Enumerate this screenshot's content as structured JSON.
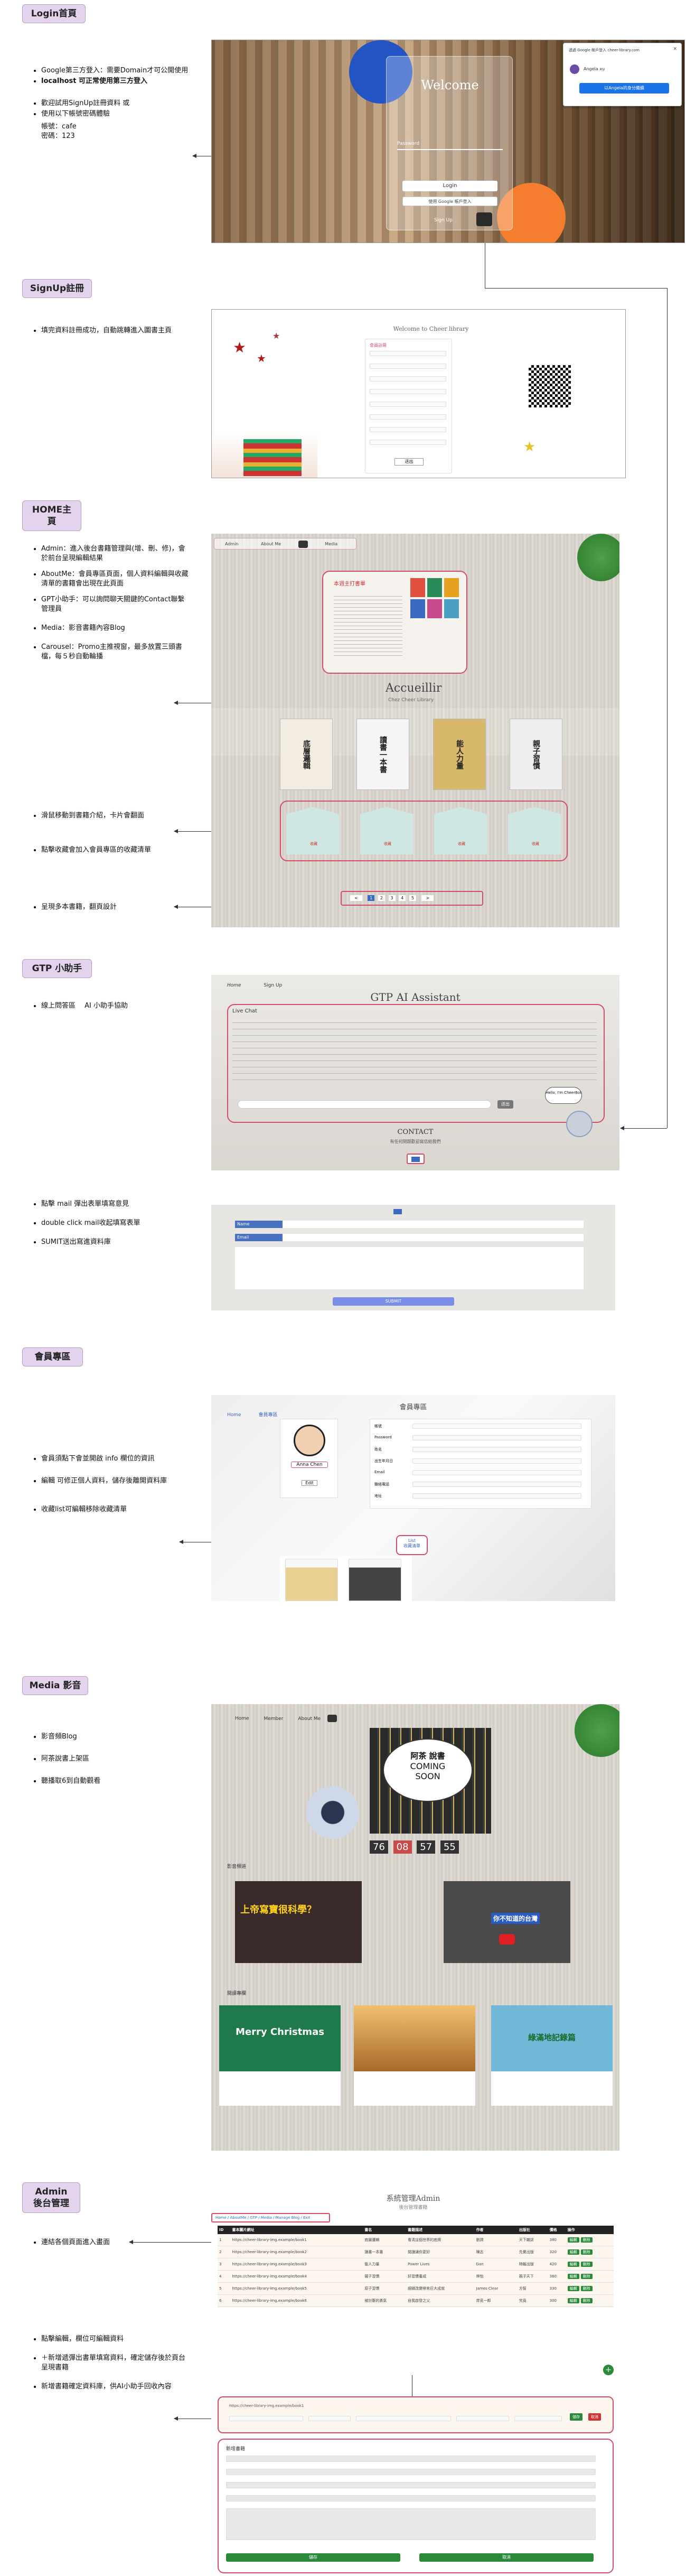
{
  "sections": {
    "login": "Login首頁",
    "signup": "SignUp註冊",
    "home": "HOME主頁",
    "gtp": "GTP 小助手",
    "member": "會員專區",
    "media": "Media 影音",
    "admin_line1": "Admin",
    "admin_line2": "後台管理"
  },
  "login_bullets": [
    "Google第三方登入：需要Domain才可公開使用",
    "localhost 可正常使用第三方登入",
    "歡迎試用SignUp註冊資料 或",
    "使用以下帳號密碼體驗",
    "帳號：cafe",
    "密碼：123"
  ],
  "login_ui": {
    "title": "Welcome",
    "password_label": "Password",
    "login_button": "Login",
    "google_button": "使用 Google 帳戶登入",
    "signup_link": "Sign Up",
    "popup_title": "透過 Google 帳戶登入 cheer-library.com",
    "popup_user": "Angela xu",
    "popup_btn": "以Angela的身分繼續"
  },
  "signup_bullets": [
    "填完資料註冊成功，自動跳轉進入圖書主頁"
  ],
  "signup_ui": {
    "title": "Welcome to Cheer library",
    "form_title": "會員註冊",
    "submit": "送出"
  },
  "home_bullets": [
    "Admin：進入後台書籍管理與(增、刪、修)，會於前台呈現編輯結果",
    "AboutMe：會員專區頁面，個人資料編輯與收藏清單的書籍會出現在此頁面",
    "GPT小助手：可以詢問聊天關鍵的Contact聯繫管理員",
    "Media：影音書籍內容Blog",
    "Carousel：Promo主推視窗，最多放置三頭書檔，每５秒自動輪播",
    "滑鼠移動到書籍介紹，卡片會翻面",
    "點擊收藏會加入會員專區的收藏清單",
    "呈現多本書籍，翻頁設計"
  ],
  "home_ui": {
    "nav": [
      "Admin",
      "About Me",
      "Media"
    ],
    "promo_title": "本週主打書單",
    "hero_title": "Accueillir",
    "hero_sub": "Chez Cheer Library",
    "books": [
      "底層邏輯",
      "讀書一本書",
      "能人力量",
      "親子習慣"
    ],
    "card_btn": "收藏",
    "pagination": [
      "<",
      "1",
      "2",
      "3",
      "4",
      "5",
      ">"
    ]
  },
  "gtp_bullets": [
    "線上問答區　 AI 小助手協助"
  ],
  "gtp_bullets2": [
    "點擊 mail 彈出表單填寫意見",
    "double click mail收起填寫表單",
    "SUMIT送出寫進資料庫"
  ],
  "gtp_ui": {
    "nav": [
      "Home",
      "Sign Up"
    ],
    "title": "GTP AI Assistant",
    "chat_label": "Live Chat",
    "send": "送出",
    "contact": "CONTACT",
    "contact_sub": "有任何問題歡迎寫信給我們",
    "form_name": "Name",
    "form_email": "Email",
    "submit": "SUBMIT",
    "robot_bubble": "Hello, I'm CheerBot"
  },
  "member_bullets": [
    "會員須點下會並開啟 info 欄位的資訊",
    "編輯 可修正個人資料，儲存後離開資料庫",
    "收藏list可編輯移除收藏清單"
  ],
  "member_ui": {
    "nav": [
      "Home",
      "會員專區"
    ],
    "title": "會員專區",
    "name": "Anna Chen",
    "edit": "Edit",
    "fields": [
      "帳號",
      "Password",
      "姓名",
      "出生年月日",
      "Email",
      "聯絡電話",
      "地址"
    ],
    "list_btn": "List",
    "fav_title": "收藏清單"
  },
  "media_bullets": [
    "影音頻Blog",
    "阿茶說書上架區",
    "聽播取6到自動觀看"
  ],
  "media_ui": {
    "nav": [
      "Home",
      "Member",
      "About Me"
    ],
    "bubble": "阿茶 說書",
    "coming": "COMING",
    "soon": "SOON",
    "countdown": [
      "76",
      "08",
      "57",
      "55"
    ],
    "channel": "影音頻道",
    "video1": "上帝寫寶很科學？",
    "video2": "你不知道的台灣",
    "blog": "閱讀專欄",
    "blog1": "Merry Christmas",
    "blog3": "綠滿地記錄篇"
  },
  "admin_bullets": [
    "連結各個頁面進入畫面"
  ],
  "admin_bullets2": [
    "點擊編輯，欄位可編輯資料",
    "＋新增遞彈出書單填寫資料，確定儲存後於頁台呈現書籍",
    "新增書籍確定資料庫，供AI小助手回收內容"
  ],
  "admin_ui": {
    "title": "系統管理Admin",
    "subtitle": "後台管理書籍",
    "breadcrumb": [
      "Home",
      "AboutMe",
      "GTP",
      "Media",
      "Manage Blog",
      "Exit"
    ],
    "columns": [
      "ID",
      "書本圖片網址",
      "書名",
      "書籍描述",
      "作者",
      "出版社",
      "價格",
      "操作"
    ],
    "edit": "編輯",
    "delete": "刪除",
    "form_title": "新增書籍",
    "save": "儲存",
    "cancel": "取消"
  },
  "admin_rows": [
    {
      "id": "1",
      "url": "https://cheer-library-img.example/book1",
      "name": "底層邏輯",
      "desc": "看清這個世界的底牌",
      "author": "劉潤",
      "pub": "天下雜誌",
      "price": "380"
    },
    {
      "id": "2",
      "url": "https://cheer-library-img.example/book2",
      "name": "讀書一本書",
      "desc": "閱讀讓你更好",
      "author": "陳志",
      "pub": "先覺出版",
      "price": "320"
    },
    {
      "id": "3",
      "url": "https://cheer-library-img.example/book3",
      "name": "能人力量",
      "desc": "Power Lives",
      "author": "Dan",
      "pub": "時報出版",
      "price": "420"
    },
    {
      "id": "4",
      "url": "https://cheer-library-img.example/book4",
      "name": "親子習慣",
      "desc": "好習慣養成",
      "author": "林怡",
      "pub": "親子天下",
      "price": "360"
    },
    {
      "id": "5",
      "url": "https://cheer-library-img.example/book5",
      "name": "原子習慣",
      "desc": "細微改變帶來巨大成就",
      "author": "James Clear",
      "pub": "方智",
      "price": "330"
    },
    {
      "id": "6",
      "url": "https://cheer-library-img.example/book6",
      "name": "被討厭的勇氣",
      "desc": "自我啟發之父",
      "author": "岸見一郎",
      "pub": "究竟",
      "price": "300"
    }
  ]
}
